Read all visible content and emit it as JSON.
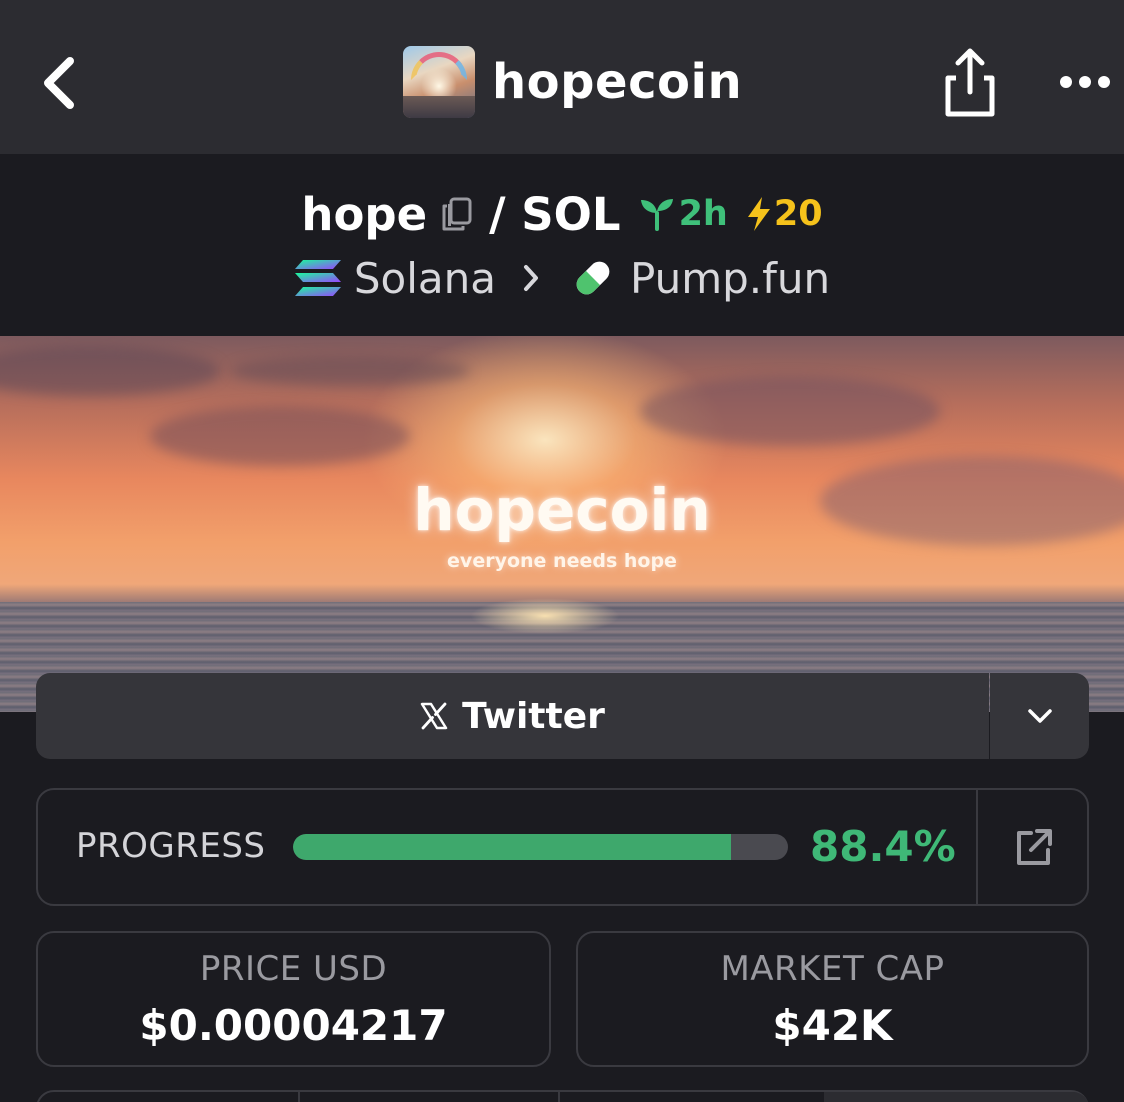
{
  "navbar": {
    "title": "hopecoin",
    "back_icon": "chevron-left-icon",
    "share_icon": "share-icon",
    "more_icon": "more-horizontal-icon"
  },
  "pair": {
    "symbol": "hope",
    "quote": "/ SOL",
    "age": "2h",
    "boosts": "20",
    "chain": "Solana",
    "dex": "Pump.fun"
  },
  "banner": {
    "title": "hopecoin",
    "tagline": "everyone needs hope"
  },
  "socials": {
    "twitter_label": "Twitter",
    "icon": "x-logo-icon"
  },
  "progress": {
    "label": "PROGRESS",
    "value_text": "88.4%",
    "percent": 88.4
  },
  "stats": [
    {
      "label": "PRICE USD",
      "value": "$0.00004217"
    },
    {
      "label": "MARKET CAP",
      "value": "$42K"
    }
  ],
  "colors": {
    "background": "#1b1b20",
    "navbar": "#2c2c31",
    "accent_green": "#3fb877",
    "boost_yellow": "#f5c21b"
  }
}
